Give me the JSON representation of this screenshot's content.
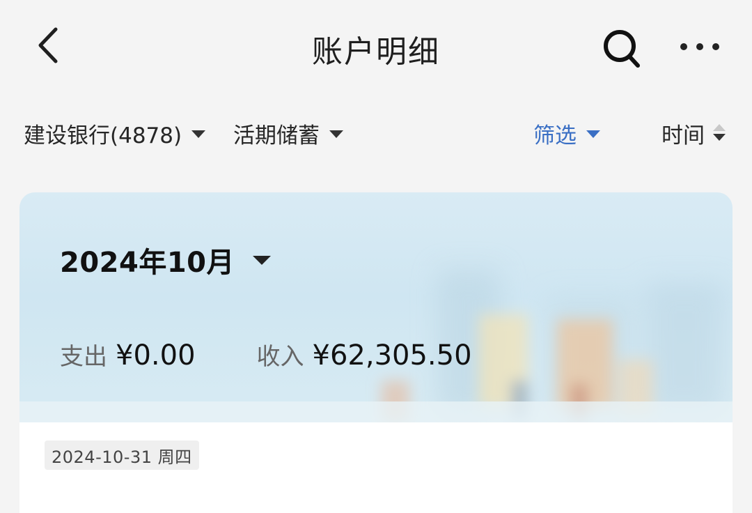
{
  "header": {
    "title": "账户明细",
    "back_icon": "chevron-left-icon",
    "search_icon": "search-icon",
    "more_icon": "more-horizontal-icon"
  },
  "filters": {
    "bank": "建设银行(4878)",
    "account_type": "活期储蓄",
    "filter": "筛选",
    "sort": "时间"
  },
  "summary": {
    "month": "2024年10月",
    "expense_label": "支出",
    "expense_value": "¥0.00",
    "income_label": "收入",
    "income_value": "¥62,305.50"
  },
  "transactions": {
    "date_header": "2024-10-31 周四"
  },
  "colors": {
    "accent": "#3a6fc4",
    "background": "#f4f4f4",
    "card": "#d4e9f3"
  }
}
